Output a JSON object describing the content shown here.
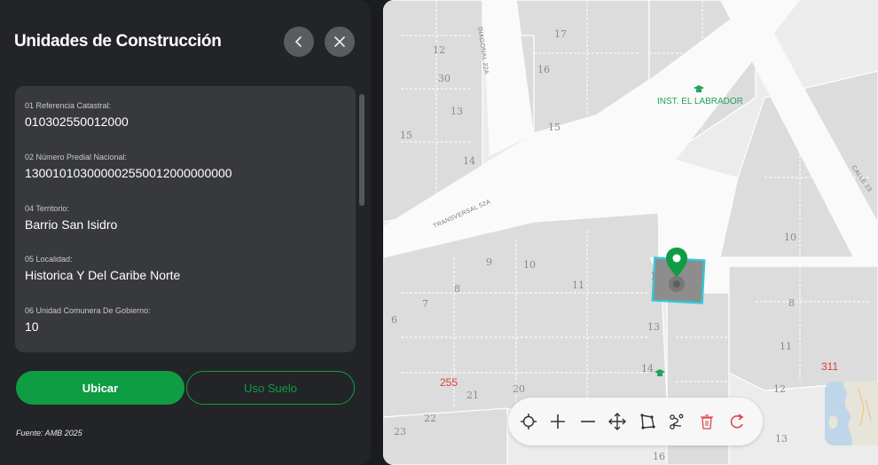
{
  "panel": {
    "title": "Unidades de Construcción",
    "fields": [
      {
        "label": "01 Referencia Catastral:",
        "value": "010302550012000"
      },
      {
        "label": "02 Número Predial Nacional:",
        "value": "130010103000002550012000000000"
      },
      {
        "label": "04 Territorio:",
        "value": "Barrio San Isidro"
      },
      {
        "label": "05 Localidad:",
        "value": "Historica Y Del Caribe Norte"
      },
      {
        "label": "06 Unidad Comunera De Gobierno:",
        "value": "10"
      }
    ],
    "buttons": {
      "primary": "Ubicar",
      "secondary": "Uso Suelo"
    },
    "source": "Fuente: AMB 2025",
    "colors": {
      "accent": "#0f9d43",
      "panel_bg": "#232427",
      "card_bg": "#38393c"
    }
  },
  "map": {
    "streets": [
      "DIAGONAL 22A",
      "TRANSVERSAL 52A",
      "CALLE 23"
    ],
    "poi": "INST. EL LABRADOR",
    "lot_numbers": [
      "17",
      "12",
      "30",
      "16",
      "13",
      "15",
      "15",
      "14",
      "10",
      "9",
      "10",
      "11",
      "8",
      "7",
      "6",
      "12",
      "13",
      "14",
      "11",
      "8",
      "12",
      "21",
      "20",
      "22",
      "23",
      "16",
      "13"
    ],
    "highlight_numbers": [
      "255",
      "311"
    ],
    "toolbar": {
      "tools": [
        "target-icon",
        "zoom-in-icon",
        "zoom-out-icon",
        "pan-icon",
        "polygon-icon",
        "route-icon",
        "delete-icon",
        "refresh-icon"
      ]
    },
    "colors": {
      "selection": "#35c7d8",
      "marker": "#0f9d43",
      "delete": "#e04848"
    }
  }
}
